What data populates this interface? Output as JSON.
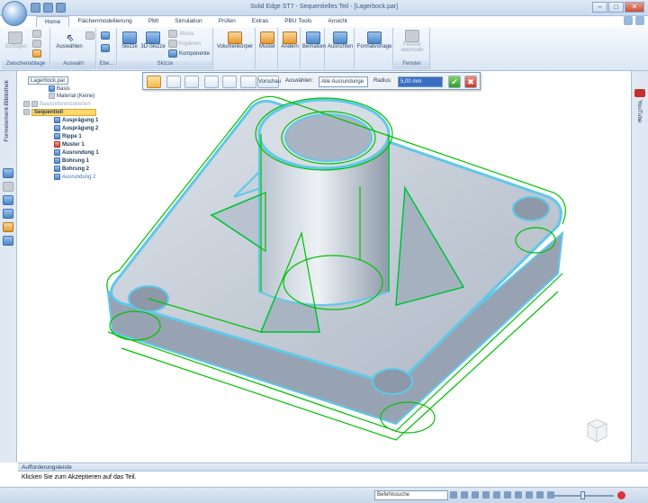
{
  "window": {
    "title": "Solid Edge ST7 - Sequentielles Teil - [Lagerbock.par]"
  },
  "tabs": [
    {
      "label": "Home",
      "active": true
    },
    {
      "label": "Flächenmodellierung"
    },
    {
      "label": "PMI"
    },
    {
      "label": "Simulation"
    },
    {
      "label": "Prüfen"
    },
    {
      "label": "Extras"
    },
    {
      "label": "PBU Tools"
    },
    {
      "label": "Ansicht"
    }
  ],
  "ribbon": {
    "clipboard": {
      "label": "Zwischenablage",
      "paste": "Einfügen"
    },
    "select": {
      "label": "Auswahl",
      "select": "Auswählen"
    },
    "planes": {
      "label": "Ebe..."
    },
    "sketch": {
      "label": "Skizze",
      "sketch": "Skizze",
      "sketch3d": "3D-Skizze",
      "abriss": "Abriss",
      "copy": "Kopieren",
      "component": "Komponente"
    },
    "solids": {
      "volume": "Volumenkörper",
      "pattern": "Muster",
      "modify": "Ändern",
      "dimension": "Bemaßen",
      "align": "Ausrichten",
      "format": "Formatvorlage"
    },
    "window": {
      "label": "Fenster",
      "switch1": "Fenster",
      "switch2": "wechseln"
    }
  },
  "command_bar": {
    "preview": "Vorschau",
    "select_label": "Auswählen:",
    "select_value": "Alle Ausrundunge",
    "radius_label": "Radius:",
    "radius_value": "5,00 mm"
  },
  "tree": {
    "root": "Lagerbock.par",
    "items": [
      {
        "label": "Basis"
      },
      {
        "label": "Material (Keine)"
      },
      {
        "label": "Basisreferenzebenen"
      },
      {
        "label": "Sequentiell"
      },
      {
        "label": "Ausprägung 1"
      },
      {
        "label": "Ausprägung 2"
      },
      {
        "label": "Rippe 1"
      },
      {
        "label": "Muster 1"
      },
      {
        "label": "Ausrundung 1"
      },
      {
        "label": "Bohrung 1"
      },
      {
        "label": "Bohrung 2"
      },
      {
        "label": "Ausrundung 2"
      }
    ]
  },
  "left_panel": {
    "title": "Formelement-Bibliothek"
  },
  "right_panel": {
    "title": "YouTube"
  },
  "prompt": {
    "header": "Aufforderungsleiste",
    "text": "Klicken Sie zum Akzeptieren auf das Teil."
  },
  "status": {
    "search_placeholder": "Befehlssuche"
  },
  "colors": {
    "highlight": "#00c000",
    "selection": "#5fc8e8",
    "part": "#c9d1dc"
  }
}
